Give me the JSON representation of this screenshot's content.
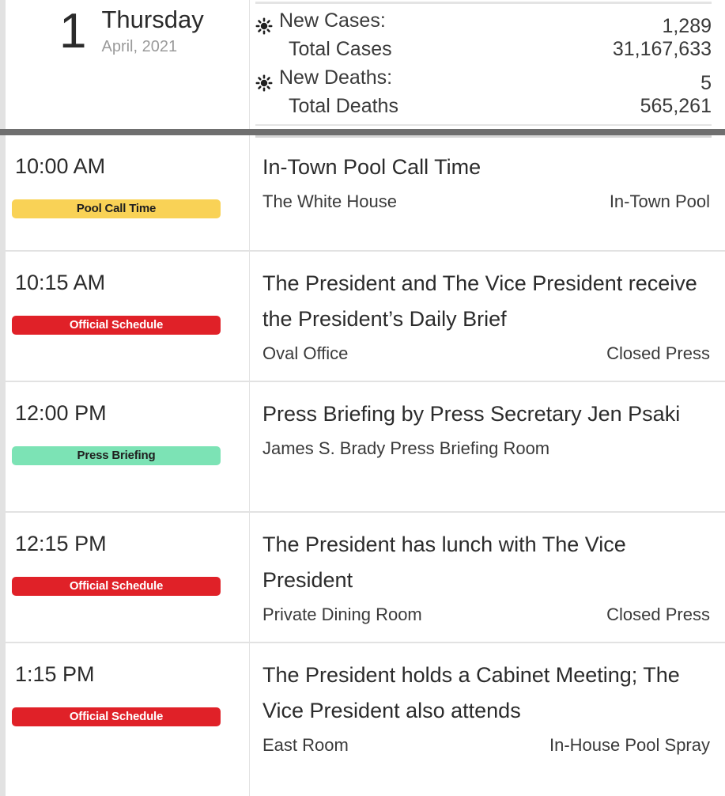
{
  "header": {
    "day_number": "1",
    "weekday": "Thursday",
    "month_year": "April, 2021",
    "stats": [
      {
        "icon": "sun-icon",
        "has_icon": true,
        "label": "New Cases:",
        "value": "1,289"
      },
      {
        "icon": "",
        "has_icon": false,
        "label": "Total Cases",
        "value": "31,167,633"
      },
      {
        "icon": "sun-icon",
        "has_icon": true,
        "label": "New Deaths:",
        "value": "5"
      },
      {
        "icon": "",
        "has_icon": false,
        "label": "Total Deaths",
        "value": "565,261"
      }
    ]
  },
  "colors": {
    "badge_pool_call_time": "#f9d256",
    "badge_official_schedule": "#e02128",
    "badge_press_briefing": "#7ce3b5",
    "divider": "#6f6f6f",
    "border": "#e2e2e2"
  },
  "schedule": {
    "events": [
      {
        "time": "10:00 AM",
        "badge": "Pool Call Time",
        "badge_type": "yellow",
        "title": "In-Town Pool Call Time",
        "location": "The White House",
        "press": "In-Town Pool"
      },
      {
        "time": "10:15 AM",
        "badge": "Official Schedule",
        "badge_type": "red",
        "title": "The President and The Vice President receive the President’s Daily Brief",
        "location": "Oval Office",
        "press": "Closed Press"
      },
      {
        "time": "12:00 PM",
        "badge": "Press Briefing",
        "badge_type": "green",
        "title": "Press Briefing by Press Secretary Jen Psaki",
        "location": "James S. Brady Press Briefing Room",
        "press": ""
      },
      {
        "time": "12:15 PM",
        "badge": "Official Schedule",
        "badge_type": "red",
        "title": "The President has lunch with The Vice President",
        "location": "Private Dining Room",
        "press": "Closed Press"
      },
      {
        "time": "1:15 PM",
        "badge": "Official Schedule",
        "badge_type": "red",
        "title": "The President holds a Cabinet Meeting; The Vice President also attends",
        "location": "East Room",
        "press": "In-House Pool Spray"
      }
    ]
  }
}
